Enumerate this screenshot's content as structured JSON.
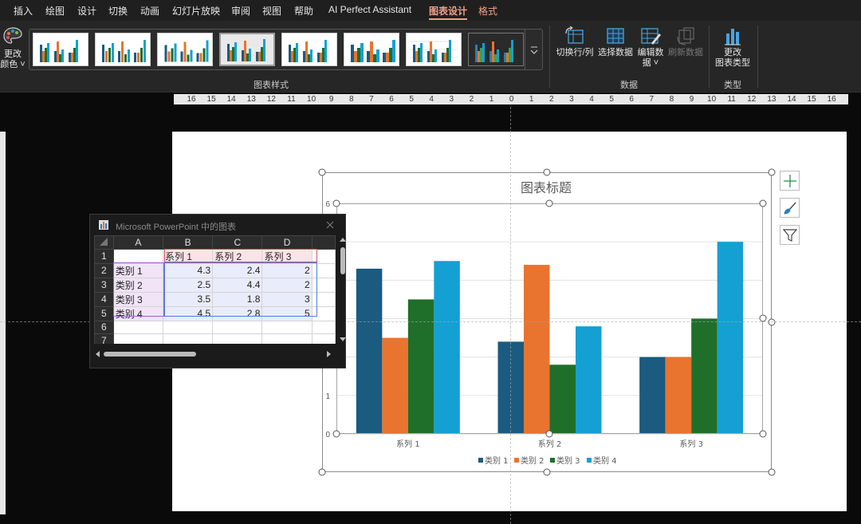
{
  "menu": {
    "tabs": [
      "插入",
      "绘图",
      "设计",
      "切换",
      "动画",
      "幻灯片放映",
      "审阅",
      "视图",
      "帮助",
      "AI Perfect Assistant",
      "图表设计",
      "格式"
    ],
    "active_tab": "图表设计"
  },
  "ribbon": {
    "change_colors": {
      "line1": "更改",
      "line2": "颜色"
    },
    "styles_group_label": "图表样式",
    "data_group": {
      "label": "数据",
      "switch_row_col": "切换行/列",
      "select_data": "选择数据",
      "edit_data_line1": "编辑数",
      "edit_data_line2": "据",
      "refresh_data": "刷新数据"
    },
    "type_group": {
      "label": "类型",
      "change_type_line1": "更改",
      "change_type_line2": "图表类型"
    }
  },
  "ruler": {
    "labels": [
      "16",
      "15",
      "14",
      "13",
      "12",
      "11",
      "10",
      "9",
      "8",
      "7",
      "6",
      "5",
      "4",
      "3",
      "2",
      "1",
      "0",
      "1",
      "2",
      "3",
      "4",
      "5",
      "6",
      "7",
      "8",
      "9",
      "10",
      "11",
      "12",
      "13",
      "14",
      "15",
      "16"
    ]
  },
  "colors": {
    "series_1": "#1a5b7f",
    "series_2": "#e8742f",
    "series_3": "#1f6f2a",
    "series_4": "#14a0d3",
    "active_tab": "#f0a088"
  },
  "chart_data": {
    "type": "bar",
    "title": "图表标题",
    "categories": [
      "系列 1",
      "系列 2",
      "系列 3"
    ],
    "series": [
      {
        "name": "类别 1",
        "values": [
          4.3,
          2.4,
          2
        ]
      },
      {
        "name": "类别 2",
        "values": [
          2.5,
          4.4,
          2
        ]
      },
      {
        "name": "类别 3",
        "values": [
          3.5,
          1.8,
          3
        ]
      },
      {
        "name": "类别 4",
        "values": [
          4.5,
          2.8,
          5
        ]
      }
    ],
    "yticks": [
      "0",
      "1",
      "6"
    ],
    "ylim": [
      0,
      6
    ],
    "grid": true,
    "legend": "bottom"
  },
  "sheet": {
    "title": "Microsoft PowerPoint 中的图表",
    "col_headers": [
      "A",
      "B",
      "C",
      "D"
    ],
    "row_headers": [
      "1",
      "2",
      "3",
      "4",
      "5",
      "6",
      "7"
    ],
    "rows": [
      [
        "",
        "系列 1",
        "系列 2",
        "系列 3"
      ],
      [
        "类别 1",
        "4.3",
        "2.4",
        "2"
      ],
      [
        "类别 2",
        "2.5",
        "4.4",
        "2"
      ],
      [
        "类别 3",
        "3.5",
        "1.8",
        "3"
      ],
      [
        "类别 4",
        "4.5",
        "2.8",
        "5"
      ],
      [
        "",
        "",
        "",
        ""
      ],
      [
        "",
        "",
        "",
        ""
      ]
    ]
  }
}
